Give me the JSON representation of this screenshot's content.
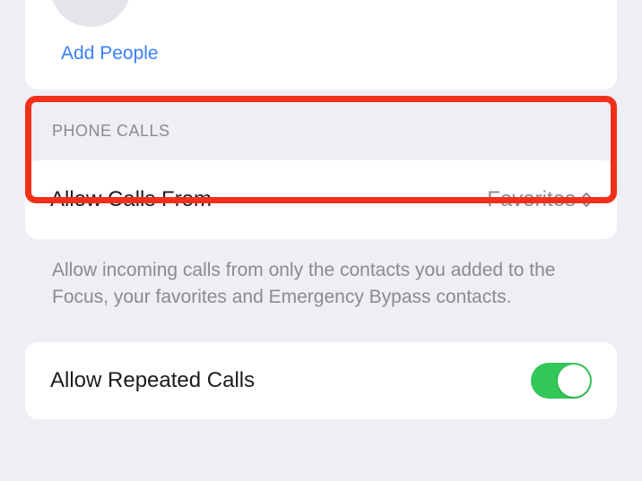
{
  "people": {
    "add_button_label": "Add People"
  },
  "phone_calls": {
    "section_header": "Phone Calls",
    "allow_from_label": "Allow Calls From",
    "allow_from_value": "Favorites",
    "footer": "Allow incoming calls from only the contacts you added to the Focus, your favorites and Emergency Bypass contacts."
  },
  "repeated_calls": {
    "label": "Allow Repeated Calls",
    "enabled": true
  }
}
